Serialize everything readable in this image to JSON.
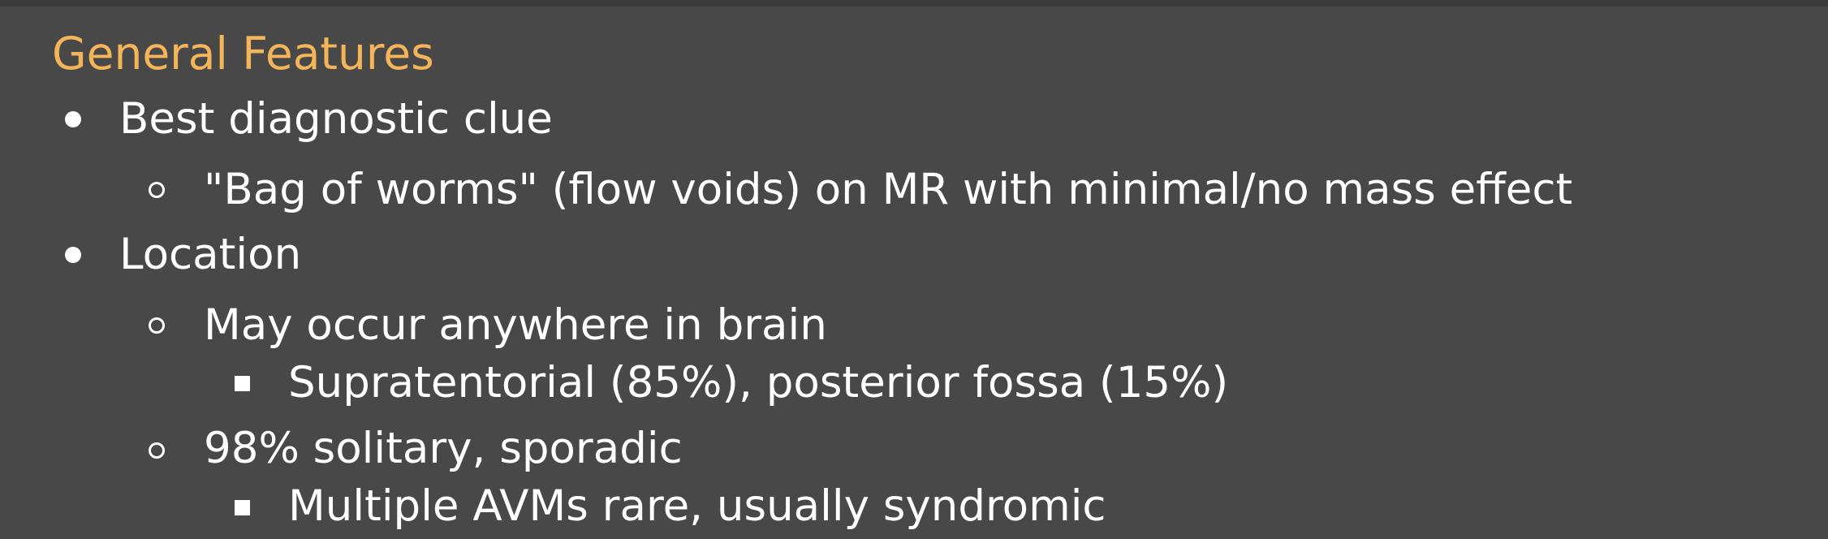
{
  "heading": "General Features",
  "items": [
    {
      "level": 1,
      "text": "Best diagnostic clue"
    },
    {
      "level": 2,
      "text": "\"Bag of worms\" (flow voids) on MR with minimal/no mass effect"
    },
    {
      "level": 1,
      "text": "Location"
    },
    {
      "level": 2,
      "text": "May occur anywhere in brain"
    },
    {
      "level": 3,
      "text": "Supratentorial (85%), posterior fossa (15%)"
    },
    {
      "level": 2,
      "text": "98% solitary, sporadic"
    },
    {
      "level": 3,
      "text": "Multiple AVMs rare, usually syndromic"
    }
  ],
  "colors": {
    "background": "#484848",
    "heading": "#f4b55a",
    "text": "#ffffff"
  }
}
